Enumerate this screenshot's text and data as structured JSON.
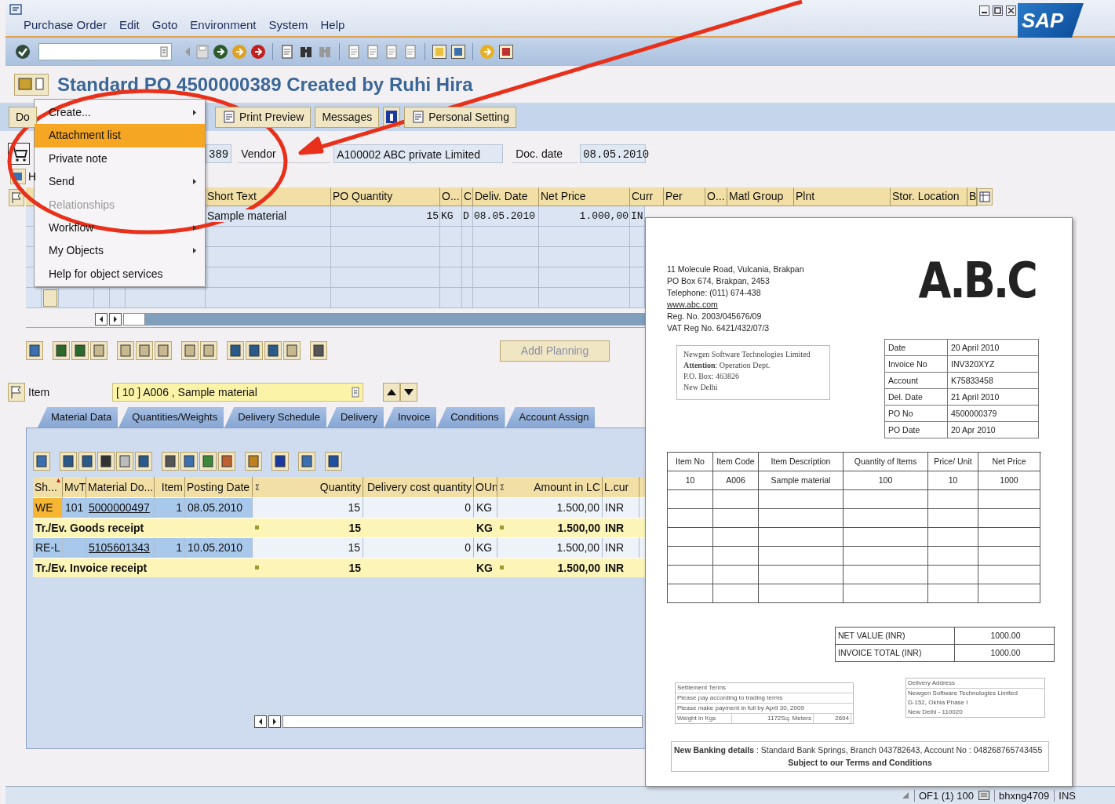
{
  "window": {
    "logo": "SAP"
  },
  "menu_bar": [
    "Purchase Order",
    "Edit",
    "Goto",
    "Environment",
    "System",
    "Help"
  ],
  "title": "Standard PO 4500000389 Created by Ruhi Hira",
  "app_toolbar": [
    {
      "kind": "text",
      "label": "Do"
    },
    {
      "kind": "icon_text",
      "label": "Print Preview"
    },
    {
      "kind": "text",
      "label": "Messages"
    },
    {
      "kind": "icon"
    },
    {
      "kind": "icon_text",
      "label": "Personal Setting"
    }
  ],
  "header": {
    "header_label": "H",
    "po_number": "389",
    "vendor_label": "Vendor",
    "vendor": "A100002 ABC private Limited",
    "doc_date_label": "Doc. date",
    "doc_date": "08.05.2010"
  },
  "context_menu": [
    {
      "label": "Create...",
      "submenu": true,
      "selected": false,
      "disabled": false
    },
    {
      "label": "Attachment list",
      "submenu": false,
      "selected": true,
      "disabled": false
    },
    {
      "label": "Private note",
      "submenu": false,
      "selected": false,
      "disabled": false
    },
    {
      "label": "Send",
      "submenu": true,
      "selected": false,
      "disabled": false
    },
    {
      "label": "Relationships",
      "submenu": false,
      "selected": false,
      "disabled": true
    },
    {
      "label": "Workflow",
      "submenu": true,
      "selected": false,
      "disabled": false
    },
    {
      "label": "My Objects",
      "submenu": true,
      "selected": false,
      "disabled": false
    },
    {
      "label": "Help for object services",
      "submenu": false,
      "selected": false,
      "disabled": false
    }
  ],
  "item_table": {
    "columns": [
      "Short Text",
      "PO Quantity",
      "O...",
      "C",
      "Deliv. Date",
      "Net Price",
      "Curr",
      "Per",
      "O...",
      "Matl Group",
      "Plnt",
      "Stor. Location",
      "B"
    ],
    "rows": [
      {
        "cells": [
          "Sample material",
          "15",
          "KG",
          "D",
          "08.05.2010",
          "1.000,00",
          "IN"
        ]
      }
    ]
  },
  "addl_planning": {
    "label": "Addl Planning",
    "disabled": true
  },
  "item_selector": {
    "label": "Item",
    "value": "[ 10 ] A006 , Sample material"
  },
  "tabs": [
    {
      "label": "Material Data",
      "selected": false
    },
    {
      "label": "Quantities/Weights",
      "selected": false
    },
    {
      "label": "Delivery Schedule",
      "selected": false
    },
    {
      "label": "Delivery",
      "selected": false
    },
    {
      "label": "Invoice",
      "selected": false
    },
    {
      "label": "Conditions",
      "selected": false
    },
    {
      "label": "Account Assign",
      "selected": false
    }
  ],
  "history_table": {
    "columns": [
      {
        "label": "Sh...",
        "sum": false
      },
      {
        "label": "MvT",
        "sum": false
      },
      {
        "label": "Material Do...",
        "sum": false
      },
      {
        "label": "Item",
        "sum": false
      },
      {
        "label": "Posting Date",
        "sum": false
      },
      {
        "label": "Quantity",
        "sum": true
      },
      {
        "label": "Delivery cost quantity",
        "sum": false
      },
      {
        "label": "OUn",
        "sum": false
      },
      {
        "label": "Amount in LC",
        "sum": true
      },
      {
        "label": "L.cur",
        "sum": false
      }
    ],
    "rows": [
      {
        "kind": "item",
        "highlighted": true,
        "sh": "WE",
        "mvt": "101",
        "material_doc": "5000000497",
        "item": "1",
        "posting_date": "08.05.2010",
        "quantity": "15",
        "delivery_cost_quantity": "0",
        "unit": "KG",
        "amount": "1.500,00",
        "currency": "INR"
      },
      {
        "kind": "total",
        "label": "Tr./Ev. Goods receipt",
        "quantity": "15",
        "unit": "KG",
        "amount": "1.500,00",
        "currency": "INR"
      },
      {
        "kind": "item",
        "highlighted": false,
        "sh": "RE-L",
        "material_doc": "5105601343",
        "item": "1",
        "posting_date": "10.05.2010",
        "quantity": "15",
        "delivery_cost_quantity": "0",
        "unit": "KG",
        "amount": "1.500,00",
        "currency": "INR"
      },
      {
        "kind": "total",
        "label": "Tr./Ev. Invoice receipt",
        "quantity": "15",
        "unit": "KG",
        "amount": "1.500,00",
        "currency": "INR"
      }
    ]
  },
  "invoice": {
    "address_lines": [
      {
        "text": "11 Molecule Road, Vulcania, Brakpan",
        "link": false
      },
      {
        "text": "PO Box 674, Brakpan, 2453",
        "link": false
      },
      {
        "text": "Telephone: (011) 674-438",
        "link": false
      },
      {
        "text": "www.abc.com",
        "link": true
      },
      {
        "text": "Reg. No. 2003/045676/09",
        "link": false
      },
      {
        "text": "VAT Reg No. 6421/432/07/3",
        "link": false
      }
    ],
    "logo": "A.B.C",
    "recipient_lines": [
      "Newgen Software Technologies Limited",
      "**Attention**: Operation Dept.",
      "P.O. Box: 463826",
      "New Delhi"
    ],
    "info": [
      {
        "label": "Date",
        "value": "20 April 2010"
      },
      {
        "label": "Invoice No",
        "value": "INV320XYZ"
      },
      {
        "label": "Account",
        "value": "K75833458"
      },
      {
        "label": "Del. Date",
        "value": "21 April 2010"
      },
      {
        "label": "PO No",
        "value": "4500000379"
      },
      {
        "label": "PO Date",
        "value": "20 Apr 2010"
      }
    ],
    "items": {
      "columns": [
        "Item No",
        "Item Code",
        "Item Description",
        "Quantity of Items",
        "Price/ Unit",
        "Net Price"
      ],
      "rows": [
        [
          "10",
          "A006",
          "Sample material",
          "100",
          "10",
          "1000"
        ]
      ]
    },
    "totals": [
      {
        "label": "NET VALUE (INR)",
        "value": "1000.00"
      },
      {
        "label": "INVOICE TOTAL (INR)",
        "value": "1000.00"
      }
    ],
    "settlement": {
      "title": "Settlement Terms",
      "lines": [
        "Please pay according to trading terms",
        "Please make payment in full by April 30, 2009"
      ],
      "weight": [
        "Weight in Kgs",
        "1172Sq. Meters",
        "2694"
      ]
    },
    "delivery": {
      "title": "Delivery Address",
      "lines": [
        "Newgen Software Technologies Limited",
        "D-152, Okhla Phase I",
        "New Delhi - 110020"
      ]
    },
    "banking": "**New Banking details** : Standard Bank Springs, Branch 043782643, Account No : 048268765743455",
    "terms": "Subject to our Terms and Conditions"
  },
  "status_bar": [
    "OF1 (1) 100",
    "bhxng4709",
    "INS"
  ]
}
